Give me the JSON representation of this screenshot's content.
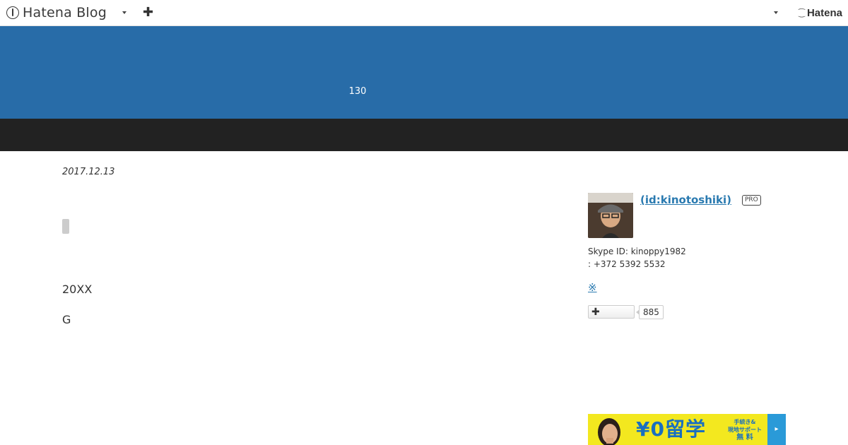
{
  "topbar": {
    "logo_text": "Hatena Blog",
    "add_label": "✚",
    "hatena_label": "Hatena"
  },
  "banner": {
    "title": "130"
  },
  "article": {
    "date": "2017.12.13",
    "paragraphs": [
      "20XX",
      "G"
    ]
  },
  "sidebar": {
    "author_name": " (id:kinotoshiki)",
    "pro_badge": "PRO",
    "skype": "Skype ID: kinoppy1982",
    "phone": ": +372 5392 5532",
    "icon_link": "※",
    "subscribe_label": "✚",
    "subscribe_count": "885"
  },
  "ad": {
    "main_text": "¥0留学",
    "sub_line1": "手続き&",
    "sub_line2": "現地サポート",
    "sub_line3": "無 料",
    "arrow": "▸"
  },
  "colors": {
    "banner": "#286ca8",
    "darkbar": "#222222",
    "link": "#2a7ab0",
    "ad_bg": "#f3e81f",
    "ad_text": "#1a6fc0"
  }
}
